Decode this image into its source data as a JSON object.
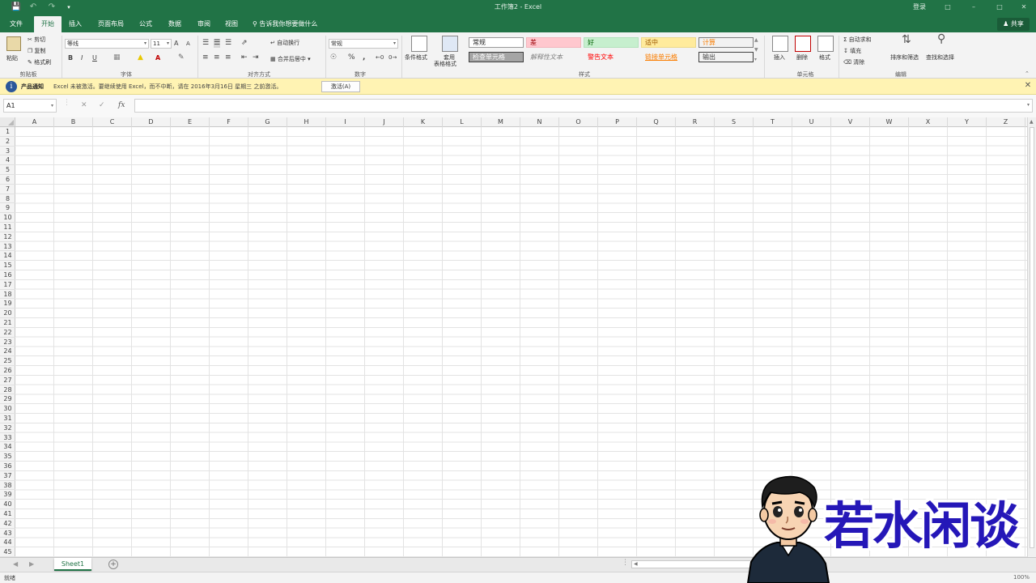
{
  "titlebar": {
    "title": "工作簿2 - Excel",
    "login": "登录",
    "save_icon": "save-icon",
    "undo_icon": "undo-icon",
    "redo_icon": "redo-icon"
  },
  "tabs": [
    "文件",
    "开始",
    "插入",
    "页面布局",
    "公式",
    "数据",
    "审阅",
    "视图"
  ],
  "active_tab": "开始",
  "tellme": "告诉我你想要做什么",
  "share": "共享",
  "ribbon": {
    "clipboard": {
      "label": "剪贴板",
      "paste": "粘贴",
      "cut": "剪切",
      "copy": "复制",
      "format_painter": "格式刷"
    },
    "font": {
      "label": "字体",
      "font_name": "等线",
      "font_size": "11",
      "bold": "B",
      "italic": "I",
      "underline": "U",
      "increase": "A",
      "decrease": "A",
      "font_color": "A"
    },
    "alignment": {
      "label": "对齐方式",
      "wrap": "自动换行",
      "merge": "合并后居中"
    },
    "number": {
      "label": "数字",
      "format": "常规",
      "percent": "%",
      "comma": ","
    },
    "styles": {
      "label": "样式",
      "conditional": "条件格式",
      "table_format_1": "套用",
      "table_format_2": "表格格式",
      "cells": [
        {
          "text": "常规",
          "bg": "#ffffff",
          "color": "#222222",
          "border": "#999999"
        },
        {
          "text": "差",
          "bg": "#ffc7ce",
          "color": "#9c0006",
          "border": "#f2b6bd"
        },
        {
          "text": "好",
          "bg": "#c6efce",
          "color": "#006100",
          "border": "#b3e2bc"
        },
        {
          "text": "适中",
          "bg": "#ffeb9c",
          "color": "#9c5700",
          "border": "#ecd98a"
        },
        {
          "text": "计算",
          "bg": "#f2f2f2",
          "color": "#fa7d00",
          "border": "#7f7f7f"
        },
        {
          "text": "检查单元格",
          "bg": "#a5a5a5",
          "color": "#ffffff",
          "border": "#3f3f3f"
        },
        {
          "text": "解释性文本",
          "bg": "#f3f3f3",
          "color": "#7f7f7f",
          "border": "#f3f3f3"
        },
        {
          "text": "警告文本",
          "bg": "#f3f3f3",
          "color": "#ff0000",
          "border": "#f3f3f3"
        },
        {
          "text": "链接单元格",
          "bg": "#f3f3f3",
          "color": "#fa7d00",
          "border": "#f3f3f3"
        },
        {
          "text": "输出",
          "bg": "#f2f2f2",
          "color": "#3f3f3f",
          "border": "#3f3f3f"
        }
      ]
    },
    "cells": {
      "label": "单元格",
      "insert": "插入",
      "delete": "删除",
      "format": "格式"
    },
    "editing": {
      "label": "编辑",
      "autosum": "自动求和",
      "fill": "填充",
      "clear": "清除",
      "sort": "排序和筛选",
      "find": "查找和选择"
    }
  },
  "notification": {
    "title": "产品通知",
    "text": "Excel 未被激活。要继续使用 Excel，而不中断，请在 2016年3月16日 星期三 之前激活。",
    "button": "激活(A)"
  },
  "formula_bar": {
    "name_box": "A1",
    "fx": "fx",
    "value": ""
  },
  "columns": [
    "A",
    "B",
    "C",
    "D",
    "E",
    "F",
    "G",
    "H",
    "I",
    "J",
    "K",
    "L",
    "M",
    "N",
    "O",
    "P",
    "Q",
    "R",
    "S",
    "T",
    "U",
    "V",
    "W",
    "X",
    "Y",
    "Z"
  ],
  "rows": [
    "1",
    "2",
    "3",
    "4",
    "5",
    "6",
    "7",
    "8",
    "9",
    "10",
    "11",
    "12",
    "13",
    "14",
    "15",
    "16",
    "17",
    "18",
    "19",
    "20",
    "21",
    "22",
    "23",
    "24",
    "25",
    "26",
    "27",
    "28",
    "29",
    "30",
    "31",
    "32",
    "33",
    "34",
    "35",
    "36",
    "37",
    "38",
    "39",
    "40",
    "41",
    "42",
    "43",
    "44",
    "45"
  ],
  "sheets": [
    "Sheet1"
  ],
  "status": {
    "ready": "就绪",
    "zoom": "100%"
  },
  "watermark": {
    "text": "若水闲谈"
  },
  "colors": {
    "accent": "#217346",
    "grid": "#e3e3e3",
    "notify_bg": "#fff3b3",
    "watermark": "#2517b8"
  }
}
